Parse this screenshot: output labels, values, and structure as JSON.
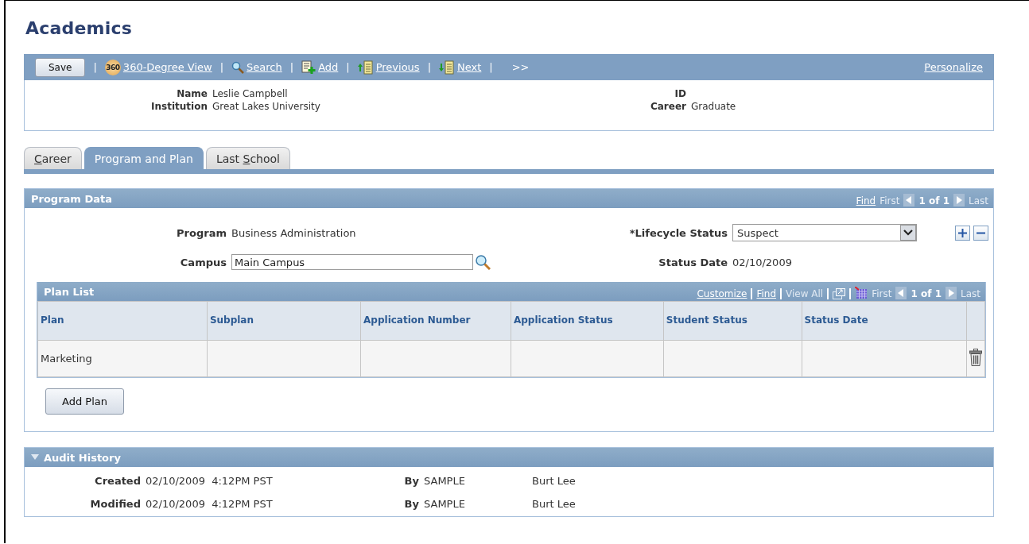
{
  "page_title": "Academics",
  "toolbar": {
    "save": "Save",
    "links": [
      {
        "kind": "sep",
        "text": "|"
      },
      {
        "kind": "view360",
        "badge": "360",
        "label": "360-Degree View"
      },
      {
        "kind": "sep",
        "text": "|"
      },
      {
        "kind": "search",
        "label": "Search"
      },
      {
        "kind": "sep",
        "text": "|"
      },
      {
        "kind": "add",
        "label": "Add"
      },
      {
        "kind": "sep",
        "text": "|"
      },
      {
        "kind": "previous",
        "label": "Previous"
      },
      {
        "kind": "sep",
        "text": "|"
      },
      {
        "kind": "next",
        "label": "Next"
      },
      {
        "kind": "sep",
        "text": "|"
      }
    ],
    "more": ">>",
    "personalize": "Personalize"
  },
  "header": {
    "left": [
      {
        "label": "Name",
        "value": "Leslie Campbell"
      },
      {
        "label": "Institution",
        "value": "Great Lakes University"
      }
    ],
    "right": [
      {
        "label": "ID"
      },
      {
        "label": "Career",
        "value": "Graduate"
      }
    ]
  },
  "tabs": [
    {
      "key": "C",
      "after": "areer",
      "selected": false
    },
    {
      "before": "Program and Plan",
      "selected": true
    },
    {
      "before": "Last ",
      "key": "S",
      "after": "chool",
      "selected": false
    }
  ],
  "program_data": {
    "title": "Program Data",
    "nav": [
      {
        "kind": "link",
        "text": "Find",
        "disabled": false
      },
      {
        "kind": "text",
        "text": "First",
        "disabled": true
      },
      {
        "kind": "prev",
        "disabled": true
      },
      {
        "kind": "count",
        "text": "1 of 1"
      },
      {
        "kind": "next",
        "disabled": true
      },
      {
        "kind": "text",
        "text": "Last",
        "disabled": true
      }
    ],
    "program_label": "Program",
    "program_value": "Business Administration",
    "campus_label": "Campus",
    "campus_value": "Main Campus",
    "lifecycle_label": "*Lifecycle Status",
    "lifecycle_value": "Suspect",
    "status_date_label": "Status Date",
    "status_date_value": "02/10/2009",
    "plan_list": {
      "title": "Plan List",
      "nav": [
        {
          "kind": "link",
          "text": "Customize",
          "disabled": false
        },
        {
          "kind": "sep"
        },
        {
          "kind": "link",
          "text": "Find",
          "disabled": false
        },
        {
          "kind": "sep"
        },
        {
          "kind": "link",
          "text": "View All",
          "disabled": true
        },
        {
          "kind": "sep"
        },
        {
          "kind": "popout"
        },
        {
          "kind": "sep"
        },
        {
          "kind": "grid"
        },
        {
          "kind": "text",
          "text": "First",
          "disabled": true
        },
        {
          "kind": "prev",
          "disabled": true
        },
        {
          "kind": "count",
          "text": "1 of 1"
        },
        {
          "kind": "next",
          "disabled": true
        },
        {
          "kind": "text",
          "text": "Last",
          "disabled": true
        }
      ],
      "columns": [
        "Plan",
        "Subplan",
        "Application Number",
        "Application Status",
        "Student Status",
        "Status Date"
      ],
      "rows": [
        [
          "Marketing",
          "",
          "",
          "",
          "",
          ""
        ]
      ]
    },
    "add_plan": "Add Plan"
  },
  "audit": {
    "title": "Audit History",
    "expanded": true,
    "rows": [
      {
        "label": "Created",
        "datetime": "02/10/2009  4:12PM PST",
        "by": "By",
        "user": "SAMPLE",
        "name": "Burt Lee"
      },
      {
        "label": "Modified",
        "datetime": "02/10/2009  4:12PM PST",
        "by": "By",
        "user": "SAMPLE",
        "name": "Burt Lee"
      }
    ]
  }
}
